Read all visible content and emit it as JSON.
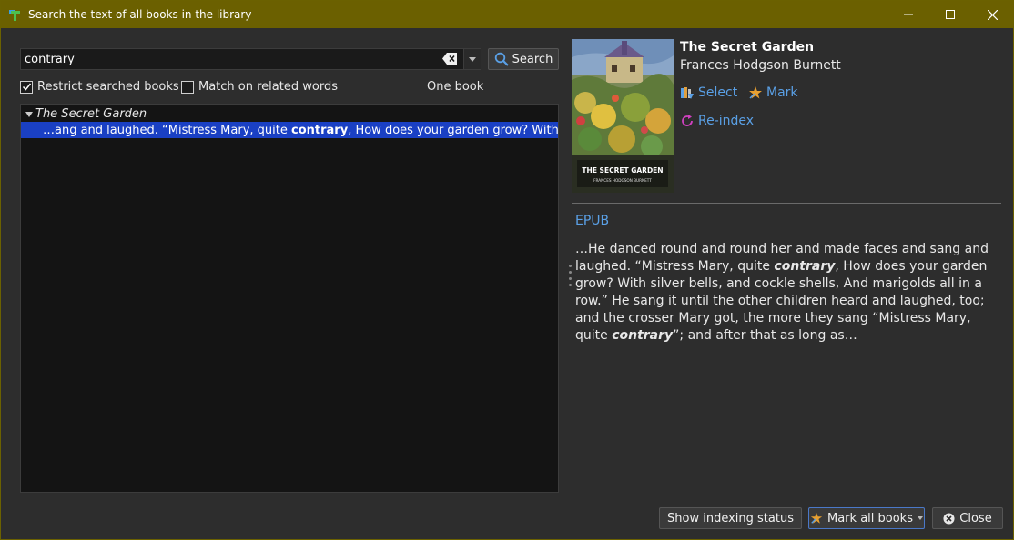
{
  "window": {
    "title": "Search the text of all books in the library"
  },
  "search": {
    "query": "contrary",
    "button_label": "Search"
  },
  "options": {
    "restrict_label": "Restrict searched books",
    "restrict_checked": true,
    "related_label": "Match on related words",
    "related_checked": false,
    "scope_text": "One book"
  },
  "results": {
    "book_title": "The Secret Garden",
    "snippet_before": "…ang and laughed. “Mistress Mary, quite ",
    "snippet_match": "contrary",
    "snippet_after": ", How does your garden grow? With silv…"
  },
  "book": {
    "title": "The Secret Garden",
    "author": "Frances Hodgson Burnett",
    "cover_title": "THE SECRET GARDEN",
    "cover_author": "FRANCES HODGSON BURNETT",
    "select_label": "Select",
    "mark_label": "Mark",
    "reindex_label": "Re-index",
    "format": "EPUB"
  },
  "preview": {
    "part1": "…He danced round and round her and made faces and sang and laughed. “Mistress Mary, quite ",
    "match1": "contrary",
    "part2": ", How does your garden grow? With silver bells, and cockle shells, And marigolds all in a row.” He sang it until the other children heard and laughed, too; and the crosser Mary got, the more they sang “Mistress Mary, quite ",
    "match2": "contrary",
    "part3": "”; and after that as long as…"
  },
  "footer": {
    "indexing_label": "Show indexing status",
    "mark_all_label": "Mark all books",
    "close_label": "Close"
  },
  "colors": {
    "titlebar": "#6b6000",
    "accent_link": "#5aa0e6",
    "selection": "#1a40c4"
  }
}
